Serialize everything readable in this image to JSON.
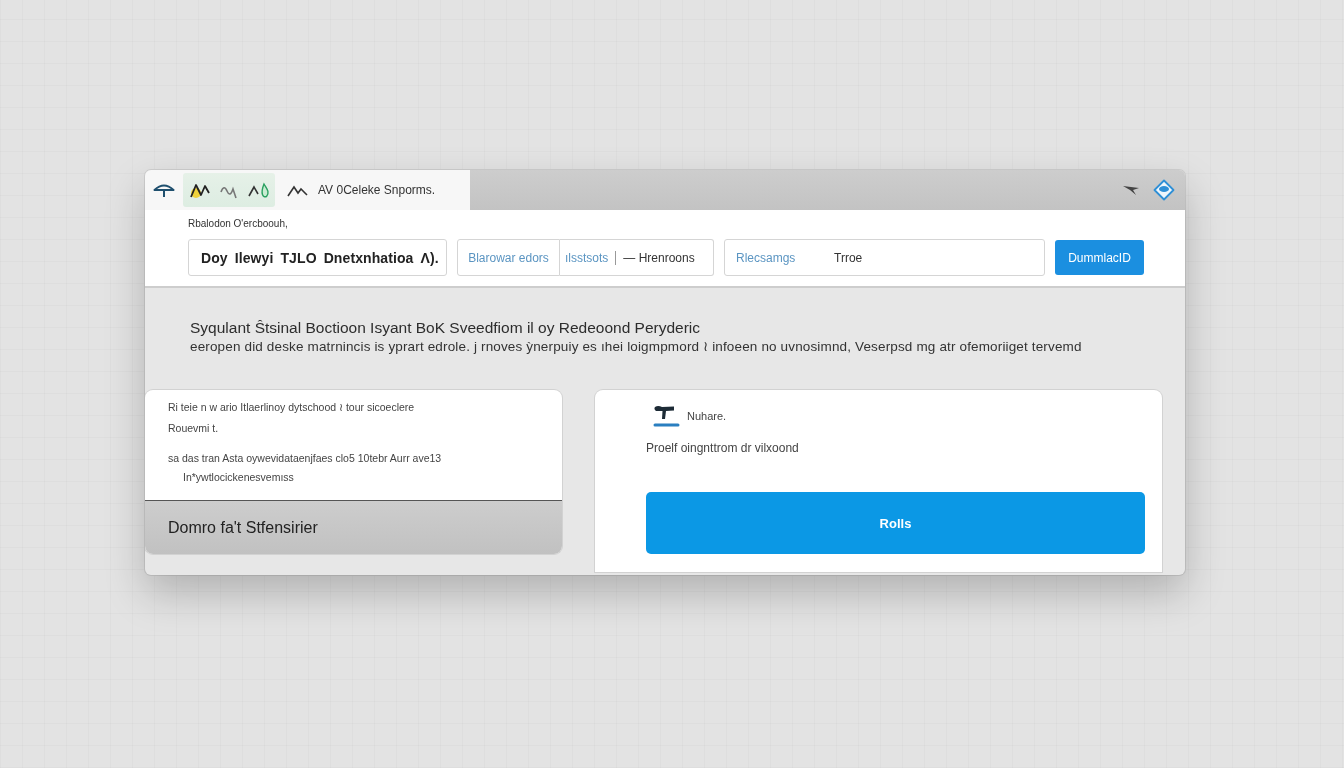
{
  "window": {
    "title_bar": {
      "tab_title": "AV 0Celeke Snporms."
    },
    "toolbar": {
      "caption": "Rbalodon O'ercboouh,",
      "query_field": {
        "value": "Doy Ɩlewyi TJLO Dnetxnhatioa Ʌ)."
      },
      "filter": {
        "chip": "Blarowar edors",
        "tag": "ılsstsots",
        "value": "— Hrenroons"
      },
      "option_field": {
        "label": "Rlecsamgs",
        "value": "Trroe"
      },
      "button": "DummlacID"
    },
    "intro": {
      "heading": "Syqulant Ŝtsinal Boctioon Ιsyant BoK Sveedfiom il oy Redeoond Peryderic",
      "text": "eeropen did deske matrnincis is yprart edrole. j rnoves ỳnerpuiy es ıhei loigmpmord ≀ infoeen no uvnosimnd, Veserpsd mg atr ofemoriiget tervemd"
    },
    "left_card": {
      "paragraphs": [
        {
          "lines": [
            "Ri teie n w ario Itlaerlinoy dytschood ≀ tour sicoeclere",
            "Rouevmi t."
          ]
        },
        {
          "lines": [
            "sa das tran Asta oywevidataenjfaes clo5 10tebr Aurr ave13"
          ],
          "children": [
            {
              "lines": [
                "In*ywtlocickenesvemıss"
              ]
            }
          ]
        }
      ],
      "footer": "Domro fa't Stfensirier"
    },
    "right_card": {
      "title": "Nuhare.",
      "text": "Proelf oingnttrom dr vilxoond",
      "button": "Rolls"
    }
  }
}
